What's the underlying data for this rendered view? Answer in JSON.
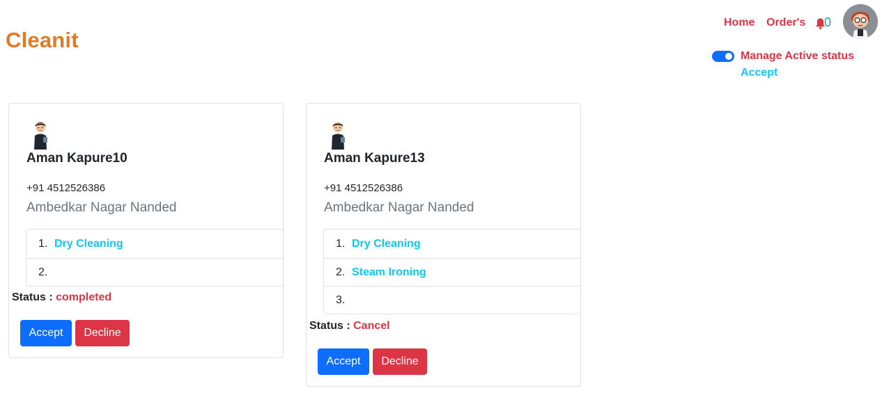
{
  "header": {
    "brand": "Cleanit",
    "nav": {
      "home": "Home",
      "orders": "Order's",
      "notification_count": "0"
    },
    "active_status": {
      "label": "Manage Active status",
      "value": "Accept",
      "toggle_on": true
    },
    "avatar_icon": "user-avatar-icon"
  },
  "colors": {
    "brand": "#e07a25",
    "danger": "#dc3545",
    "primary": "#0d6efd",
    "info": "#0dcaf0"
  },
  "cards": [
    {
      "name": "Aman Kapure10",
      "phone": "+91 4512526386",
      "address": "Ambedkar Nagar Nanded",
      "services": [
        {
          "num": "1.",
          "name": "Dry Cleaning"
        },
        {
          "num": "2.",
          "name": ""
        }
      ],
      "status_label": "Status :",
      "status_value": "completed",
      "accept_label": "Accept",
      "decline_label": "Decline"
    },
    {
      "name": "Aman Kapure13",
      "phone": "+91 4512526386",
      "address": "Ambedkar Nagar Nanded",
      "services": [
        {
          "num": "1.",
          "name": "Dry Cleaning"
        },
        {
          "num": "2.",
          "name": "Steam Ironing"
        },
        {
          "num": "3.",
          "name": ""
        }
      ],
      "status_label": "Status :",
      "status_value": "Cancel",
      "accept_label": "Accept",
      "decline_label": "Decline"
    }
  ]
}
